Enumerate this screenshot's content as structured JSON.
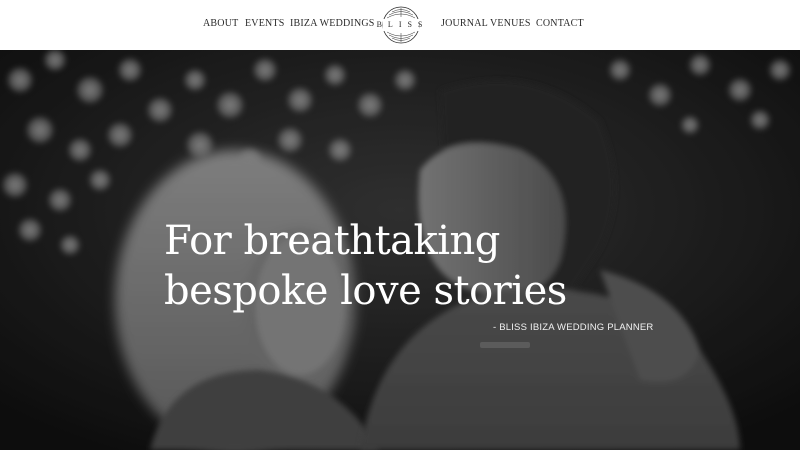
{
  "nav": {
    "items": [
      {
        "label": "ABOUT"
      },
      {
        "label": "EVENTS"
      },
      {
        "label": "IBIZA WEDDINGS"
      },
      {
        "label": "JOURNAL"
      },
      {
        "label": "VENUES"
      },
      {
        "label": "CONTACT"
      }
    ],
    "logo_text": "BLISS",
    "logo_icon": "art-deco-fan-emblem"
  },
  "hero": {
    "headline_line1": "For breathtaking",
    "headline_line2": "bespoke love stories",
    "tagline": "- BLISS IBIZA WEDDING PLANNER",
    "image": "black-and-white-couple-embracing-bokeh-lights"
  },
  "colors": {
    "header_bg": "#ffffff",
    "nav_text": "#2b2b2b",
    "hero_text": "#ffffff"
  }
}
